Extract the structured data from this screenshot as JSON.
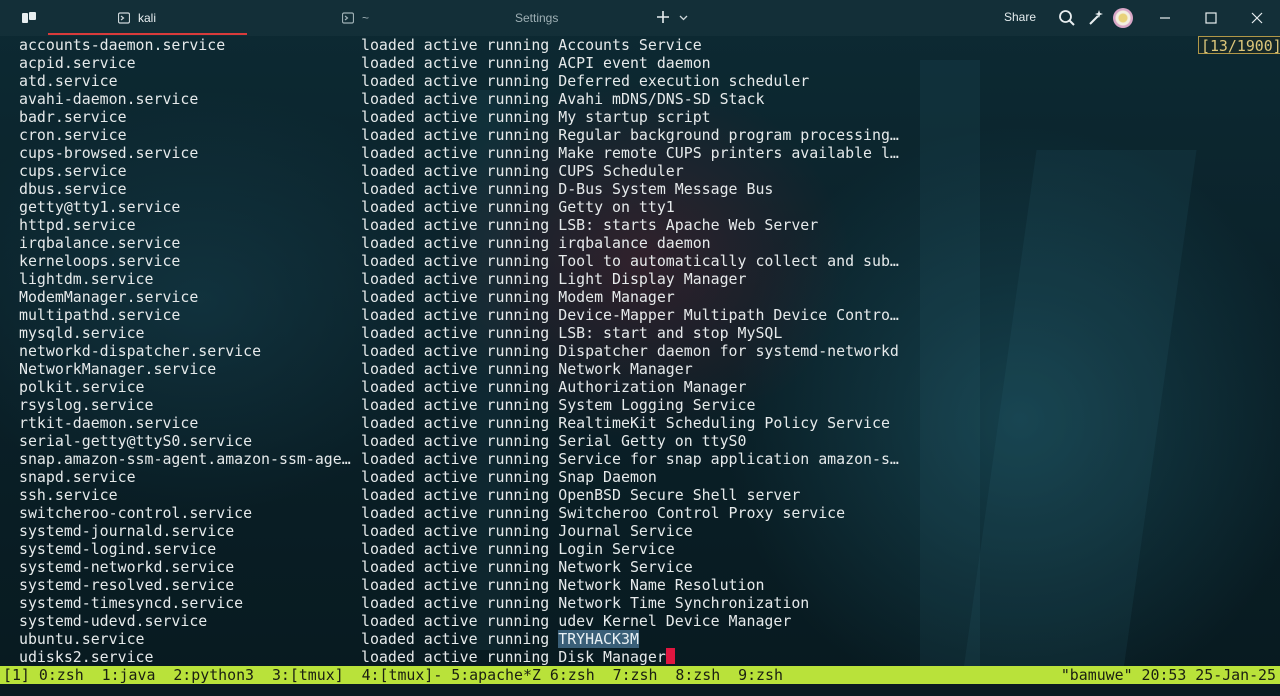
{
  "titlebar": {
    "tabs": [
      {
        "label": "kali",
        "active": true
      },
      {
        "label": "~",
        "active": false
      }
    ],
    "settings_label": "Settings",
    "share_label": "Share",
    "icons": [
      "app-logo-icon",
      "terminal-icon",
      "plus-icon",
      "chevron-down-icon",
      "search-icon",
      "sparkle-icon",
      "avatar",
      "minimize-icon",
      "maximize-icon",
      "close-icon"
    ]
  },
  "terminal": {
    "pager_position": "[13/1900]",
    "rows": [
      {
        "unit": "accounts-daemon.service",
        "status": "loaded active running Accounts Service"
      },
      {
        "unit": "acpid.service",
        "status": "loaded active running ACPI event daemon"
      },
      {
        "unit": "atd.service",
        "status": "loaded active running Deferred execution scheduler"
      },
      {
        "unit": "avahi-daemon.service",
        "status": "loaded active running Avahi mDNS/DNS-SD Stack"
      },
      {
        "unit": "badr.service",
        "status": "loaded active running My startup script"
      },
      {
        "unit": "cron.service",
        "status": "loaded active running Regular background program processing…"
      },
      {
        "unit": "cups-browsed.service",
        "status": "loaded active running Make remote CUPS printers available l…"
      },
      {
        "unit": "cups.service",
        "status": "loaded active running CUPS Scheduler"
      },
      {
        "unit": "dbus.service",
        "status": "loaded active running D-Bus System Message Bus"
      },
      {
        "unit": "getty@tty1.service",
        "status": "loaded active running Getty on tty1"
      },
      {
        "unit": "httpd.service",
        "status": "loaded active running LSB: starts Apache Web Server"
      },
      {
        "unit": "irqbalance.service",
        "status": "loaded active running irqbalance daemon"
      },
      {
        "unit": "kerneloops.service",
        "status": "loaded active running Tool to automatically collect and sub…"
      },
      {
        "unit": "lightdm.service",
        "status": "loaded active running Light Display Manager"
      },
      {
        "unit": "ModemManager.service",
        "status": "loaded active running Modem Manager"
      },
      {
        "unit": "multipathd.service",
        "status": "loaded active running Device-Mapper Multipath Device Contro…"
      },
      {
        "unit": "mysqld.service",
        "status": "loaded active running LSB: start and stop MySQL"
      },
      {
        "unit": "networkd-dispatcher.service",
        "status": "loaded active running Dispatcher daemon for systemd-networkd"
      },
      {
        "unit": "NetworkManager.service",
        "status": "loaded active running Network Manager"
      },
      {
        "unit": "polkit.service",
        "status": "loaded active running Authorization Manager"
      },
      {
        "unit": "rsyslog.service",
        "status": "loaded active running System Logging Service"
      },
      {
        "unit": "rtkit-daemon.service",
        "status": "loaded active running RealtimeKit Scheduling Policy Service"
      },
      {
        "unit": "serial-getty@ttyS0.service",
        "status": "loaded active running Serial Getty on ttyS0"
      },
      {
        "unit": "snap.amazon-ssm-agent.amazon-ssm-age…",
        "status": "loaded active running Service for snap application amazon-s…"
      },
      {
        "unit": "snapd.service",
        "status": "loaded active running Snap Daemon"
      },
      {
        "unit": "ssh.service",
        "status": "loaded active running OpenBSD Secure Shell server"
      },
      {
        "unit": "switcheroo-control.service",
        "status": "loaded active running Switcheroo Control Proxy service"
      },
      {
        "unit": "systemd-journald.service",
        "status": "loaded active running Journal Service"
      },
      {
        "unit": "systemd-logind.service",
        "status": "loaded active running Login Service"
      },
      {
        "unit": "systemd-networkd.service",
        "status": "loaded active running Network Service"
      },
      {
        "unit": "systemd-resolved.service",
        "status": "loaded active running Network Name Resolution"
      },
      {
        "unit": "systemd-timesyncd.service",
        "status": "loaded active running Network Time Synchronization"
      },
      {
        "unit": "systemd-udevd.service",
        "status": "loaded active running udev Kernel Device Manager"
      },
      {
        "unit": "ubuntu.service",
        "status_prefix": "loaded active running ",
        "status_highlight": "TRYHACK3M"
      },
      {
        "unit": "udisks2.service",
        "status": "loaded active running Disk Manager"
      }
    ]
  },
  "tmux": {
    "windows": "[1] 0:zsh  1:java  2:python3  3:[tmux]  4:[tmux]- 5:apache*Z 6:zsh  7:zsh  8:zsh  9:zsh",
    "right": "\"bamuwe\" 20:53 25-Jan-25"
  },
  "colors": {
    "accent_tab_underline": "#d83b3b",
    "tmux_bar": "#b9e23a",
    "cursor": "#e0163f",
    "selection": "#3a5f78",
    "pager_badge": "#dcc67a"
  }
}
